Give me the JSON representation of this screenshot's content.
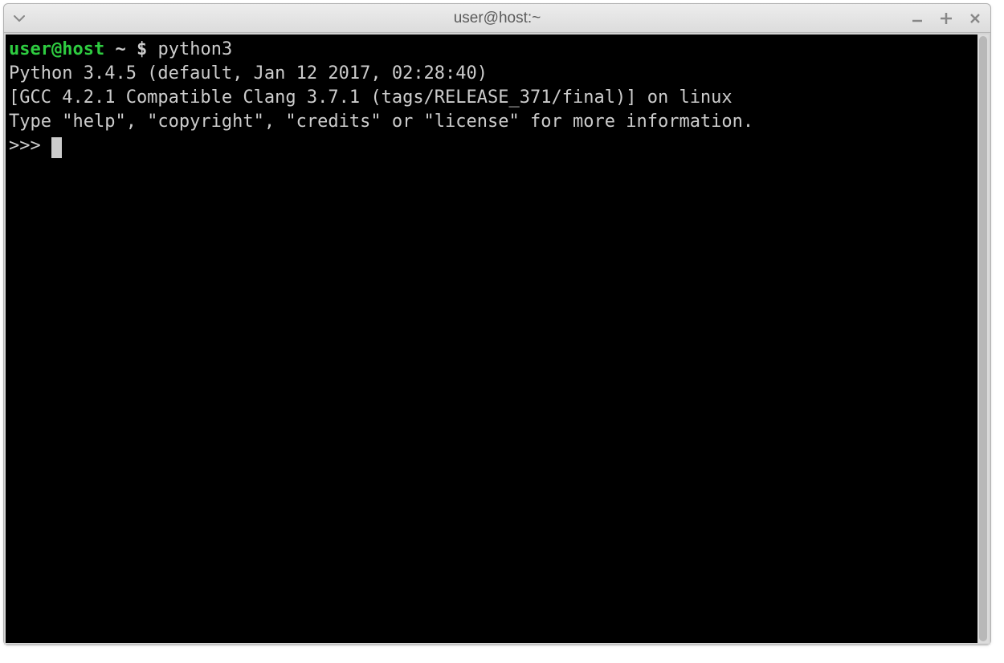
{
  "window": {
    "title": "user@host:~"
  },
  "terminal": {
    "shell_prompt": {
      "user_host": "user@host",
      "path": "~",
      "symbol": "$"
    },
    "command": "python3",
    "output_lines": [
      "Python 3.4.5 (default, Jan 12 2017, 02:28:40)",
      "[GCC 4.2.1 Compatible Clang 3.7.1 (tags/RELEASE_371/final)] on linux",
      "Type \"help\", \"copyright\", \"credits\" or \"license\" for more information."
    ],
    "python_prompt": ">>> "
  }
}
